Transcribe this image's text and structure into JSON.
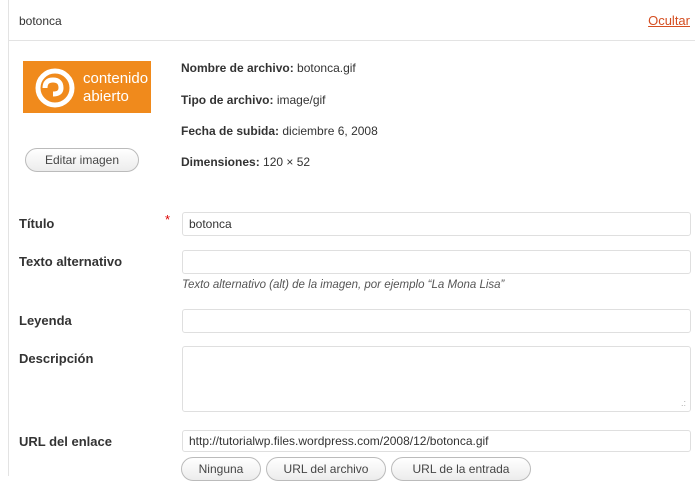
{
  "header": {
    "filename": "botonca",
    "hide_link": "Ocultar"
  },
  "thumbnail": {
    "line1": "contenido",
    "line2": "abierto",
    "bg_color": "#f08a1c"
  },
  "edit_button": "Editar imagen",
  "meta": {
    "filename_label": "Nombre de archivo:",
    "filename_value": "botonca.gif",
    "type_label": "Tipo de archivo:",
    "type_value": "image/gif",
    "date_label": "Fecha de subida:",
    "date_value": "diciembre 6, 2008",
    "dims_label": "Dimensiones:",
    "dims_value": "120 × 52"
  },
  "fields": {
    "title_label": "Título",
    "title_required": "*",
    "title_value": "botonca",
    "alt_label": "Texto alternativo",
    "alt_value": "",
    "alt_help": "Texto alternativo (alt) de la imagen, por ejemplo “La Mona Lisa”",
    "caption_label": "Leyenda",
    "caption_value": "",
    "desc_label": "Descripción",
    "desc_value": "",
    "url_label": "URL del enlace",
    "url_value": "http://tutorialwp.files.wordpress.com/2008/12/botonca.gif"
  },
  "url_buttons": {
    "none": "Ninguna",
    "file": "URL del archivo",
    "post": "URL de la entrada"
  },
  "colors": {
    "accent_link": "#d54e21",
    "required": "#dd0000"
  }
}
